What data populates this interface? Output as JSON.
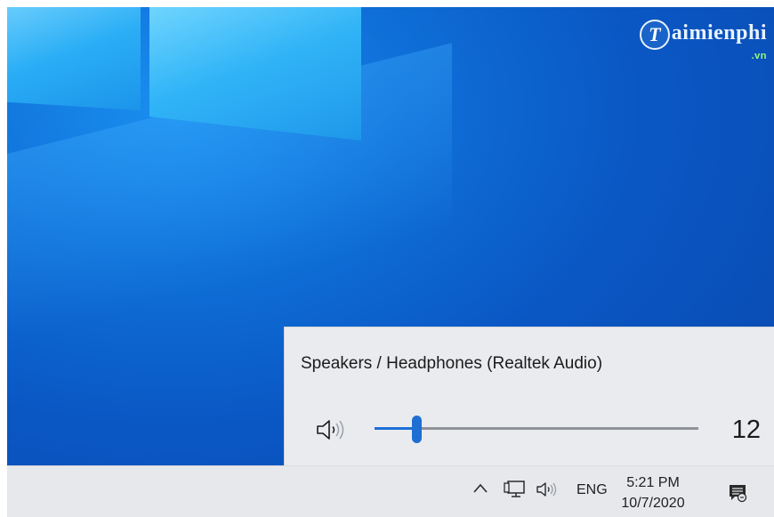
{
  "watermark": {
    "badge_letter": "T",
    "text": "aimienphi",
    "suffix": ".vn"
  },
  "volume_flyout": {
    "device_name": "Speakers / Headphones (Realtek Audio)",
    "volume_value": "12",
    "volume_fraction": 0.13,
    "icon": "speaker-icon",
    "accent_color": "#1f6fd3"
  },
  "taskbar": {
    "tray_icons": [
      "chevron-up-icon",
      "network-icon",
      "speaker-icon",
      "notification-icon"
    ],
    "language": "ENG",
    "time": "5:21 PM",
    "date": "10/7/2020"
  },
  "colors": {
    "desktop": "#0a57c4",
    "flyout_bg": "#e9ebef",
    "taskbar_bg": "#e6e8ec"
  }
}
